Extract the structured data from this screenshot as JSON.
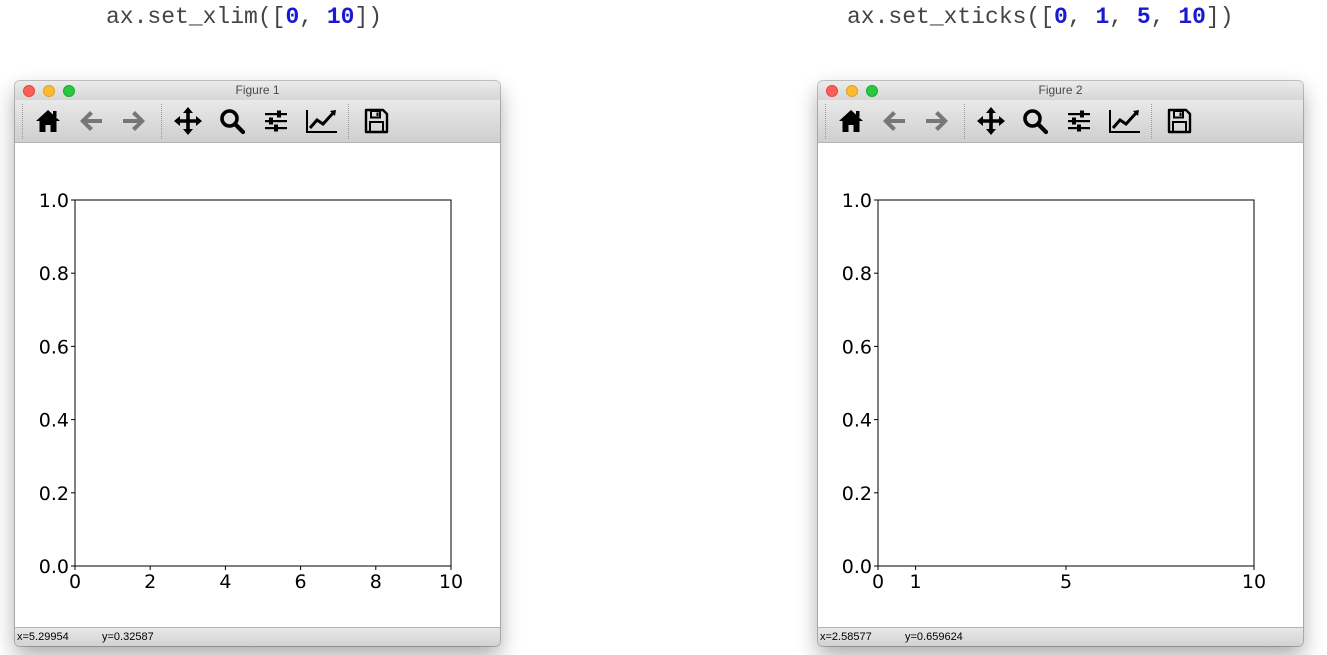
{
  "captions": {
    "left": {
      "prefix": "ax.set_xlim([",
      "values": [
        "0",
        "10"
      ],
      "suffix": "])"
    },
    "right": {
      "prefix": "ax.set_xticks([",
      "values": [
        "0",
        "1",
        "5",
        "10"
      ],
      "suffix": "])"
    }
  },
  "toolbar_icons": [
    "home-icon",
    "back-arrow-icon",
    "forward-arrow-icon",
    "pan-move-icon",
    "zoom-magnifier-icon",
    "configure-subplots-icon",
    "edit-axis-icon",
    "save-floppy-icon"
  ],
  "colors": {
    "caption_number": "#1a1ad0",
    "caption_text": "#444444",
    "traffic_close": "#fc5f57",
    "traffic_minimize": "#fdbc2e",
    "traffic_maximize": "#28c840",
    "toolbar_disabled": "#777777"
  },
  "windows": [
    {
      "title": "Figure 1",
      "status": {
        "x": "x=5.29954",
        "y": "y=0.32587"
      }
    },
    {
      "title": "Figure 2",
      "status": {
        "x": "x=2.58577",
        "y": "y=0.659624"
      }
    }
  ],
  "chart_data": [
    {
      "type": "line",
      "title": "",
      "xlabel": "",
      "ylabel": "",
      "xlim": [
        0,
        10
      ],
      "ylim": [
        0,
        1
      ],
      "xticks": [
        0,
        2,
        4,
        6,
        8,
        10
      ],
      "xtick_labels": [
        "0",
        "2",
        "4",
        "6",
        "8",
        "10"
      ],
      "yticks": [
        0,
        0.2,
        0.4,
        0.6,
        0.8,
        1.0
      ],
      "ytick_labels": [
        "0.0",
        "0.2",
        "0.4",
        "0.6",
        "0.8",
        "1.0"
      ],
      "series": [],
      "grid": false
    },
    {
      "type": "line",
      "title": "",
      "xlabel": "",
      "ylabel": "",
      "xlim": [
        0,
        10
      ],
      "ylim": [
        0,
        1
      ],
      "xticks": [
        0,
        1,
        5,
        10
      ],
      "xtick_labels": [
        "0",
        "1",
        "5",
        "10"
      ],
      "yticks": [
        0,
        0.2,
        0.4,
        0.6,
        0.8,
        1.0
      ],
      "ytick_labels": [
        "0.0",
        "0.2",
        "0.4",
        "0.6",
        "0.8",
        "1.0"
      ],
      "series": [],
      "grid": false
    }
  ]
}
